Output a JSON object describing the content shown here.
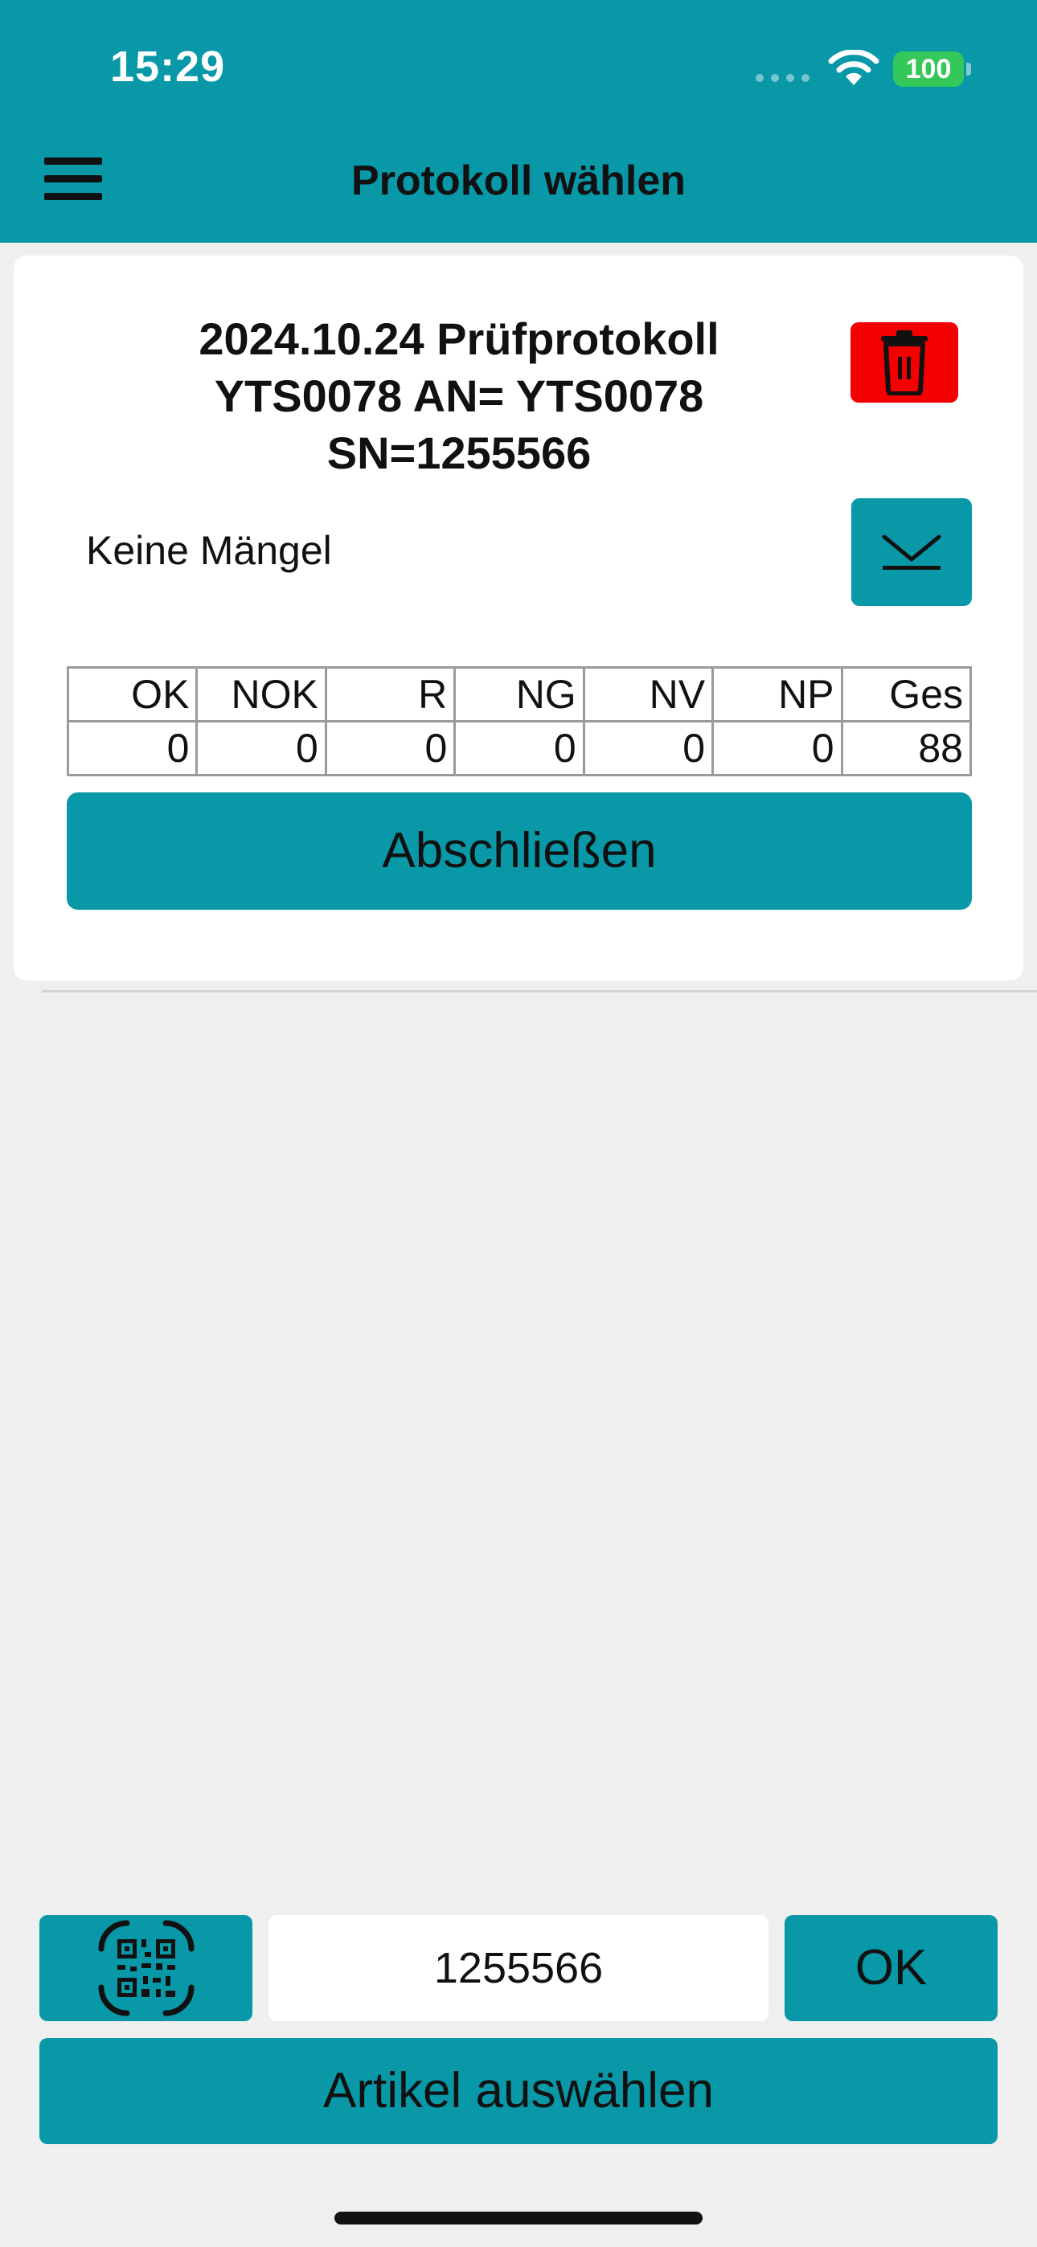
{
  "status_bar": {
    "time": "15:29",
    "battery": "100",
    "battery_color": "#34c759"
  },
  "header": {
    "title": "Protokoll wählen",
    "menu_icon": "hamburger-menu-icon",
    "background": "#0898a8"
  },
  "protocol": {
    "title_lines": [
      "2024.10.24 Prüfprotokoll",
      "YTS0078 AN= YTS0078",
      "SN=1255566"
    ],
    "defects_label": "Keine Mängel",
    "delete_icon": "trash-icon",
    "delete_color": "#f40000",
    "expand_icon": "chevron-down-icon",
    "table": {
      "headers": [
        "OK",
        "NOK",
        "R",
        "NG",
        "NV",
        "NP",
        "Ges"
      ],
      "values": [
        "0",
        "0",
        "0",
        "0",
        "0",
        "0",
        "88"
      ]
    },
    "finish_label": "Abschließen"
  },
  "bottom": {
    "qr_icon": "qr-scan-icon",
    "serial_value": "1255566",
    "ok_label": "OK",
    "article_label": "Artikel auswählen"
  }
}
